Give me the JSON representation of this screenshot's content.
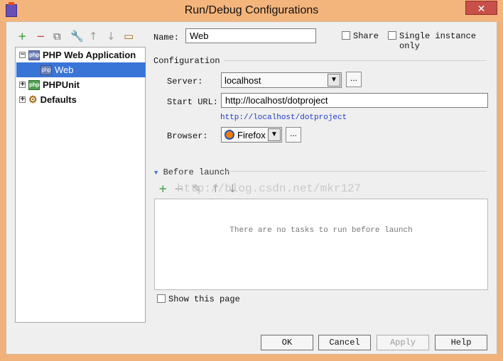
{
  "window": {
    "title": "Run/Debug Configurations",
    "close_label": "✕",
    "watermark": "http://blog.csdn.net/mkr127"
  },
  "toolbar": {
    "add": "+",
    "remove": "−",
    "copy": "⧉",
    "edit": "🔧",
    "up": "↑",
    "down": "↓",
    "folder": "▭"
  },
  "tree": {
    "items": [
      {
        "label": "PHP Web Application"
      },
      {
        "label": "Web"
      },
      {
        "label": "PHPUnit"
      },
      {
        "label": "Defaults"
      }
    ]
  },
  "form": {
    "name_label": "Name:",
    "name_value": "Web",
    "share_label": "Share",
    "single_label": "Single instance only",
    "configuration_label": "Configuration",
    "server_label": "Server:",
    "server_value": "localhost",
    "start_url_label": "Start URL:",
    "start_url_value": "http://localhost/dotproject",
    "url_preview": "http://localhost/dotproject",
    "browser_label": "Browser:",
    "browser_value": "Firefox",
    "before_launch_label": "Before launch",
    "empty_tasks": "There are no tasks to run before launch",
    "show_page_label": "Show this page",
    "dots": "..."
  },
  "buttons": {
    "ok": "OK",
    "cancel": "Cancel",
    "apply": "Apply",
    "help": "Help"
  },
  "icons": {
    "browser": "firefox-icon",
    "php": "php-icon"
  }
}
